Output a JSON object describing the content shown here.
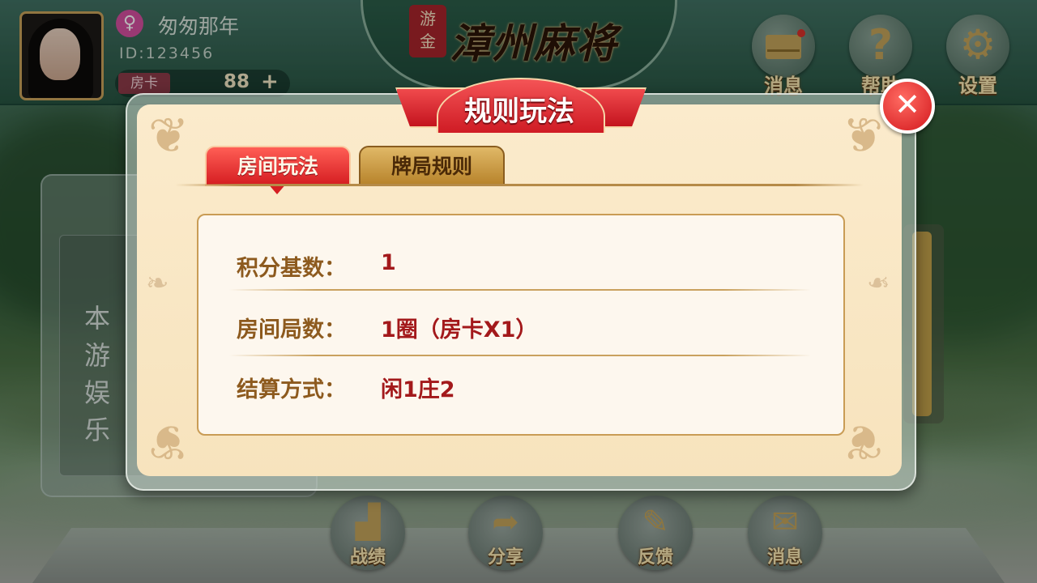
{
  "player": {
    "gender_icon": "female-icon",
    "nickname": "匆匆那年",
    "id_text": "ID:123456",
    "room_card_label": "房卡",
    "room_card_count": "88",
    "add_symbol": "+"
  },
  "logo": {
    "seal_line1": "游",
    "seal_line2": "金",
    "title": "漳州麻将"
  },
  "top_buttons": {
    "messages_label": "消息",
    "help_label": "帮助",
    "settings_label": "设置"
  },
  "background_panel": {
    "text_line1": "本游",
    "text_line2": "娱乐"
  },
  "bottom_buttons": {
    "record_label": "战绩",
    "share_label": "分享",
    "feedback_label": "反馈",
    "messages_label": "消息"
  },
  "dialog": {
    "title": "规则玩法",
    "close_symbol": "✕",
    "tabs": [
      {
        "label": "房间玩法",
        "active": true
      },
      {
        "label": "牌局规则",
        "active": false
      }
    ],
    "rules": [
      {
        "label": "积分基数：",
        "value": "1"
      },
      {
        "label": "房间局数：",
        "value": "1圈（房卡X1）"
      },
      {
        "label": "结算方式：",
        "value": "闲1庄2"
      }
    ]
  },
  "colors": {
    "accent_red": "#d51e22",
    "gold": "#c4a45a",
    "panel_cream": "#fbebcc",
    "rule_value": "#a3191b",
    "rule_label": "#8d5a1e"
  }
}
